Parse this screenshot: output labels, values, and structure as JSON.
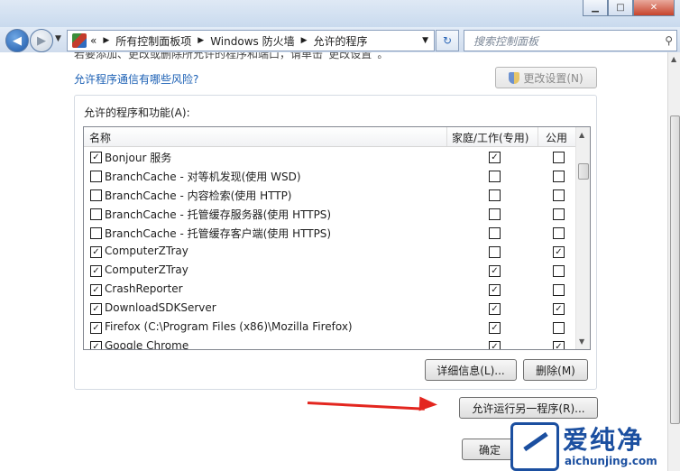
{
  "window": {
    "minimize": "▁",
    "maximize": "□",
    "close": "✕"
  },
  "nav": {
    "breadcrumb": [
      "«",
      "所有控制面板项",
      "Windows 防火墙",
      "允许的程序"
    ],
    "search_placeholder": "搜索控制面板"
  },
  "page": {
    "cut_text": "若要添加、更改或删除所允许的程序和端口，请单击“更改设置”。",
    "risk_link": "允许程序通信有哪些风险?",
    "change_settings": "更改设置(N)",
    "group_label": "允许的程序和功能(A):",
    "columns": [
      "名称",
      "家庭/工作(专用)",
      "公用"
    ],
    "rows": [
      {
        "name": "Bonjour 服务",
        "enabled": true,
        "home": true,
        "public": false
      },
      {
        "name": "BranchCache - 对等机发现(使用 WSD)",
        "enabled": false,
        "home": false,
        "public": false
      },
      {
        "name": "BranchCache - 内容检索(使用 HTTP)",
        "enabled": false,
        "home": false,
        "public": false
      },
      {
        "name": "BranchCache - 托管缓存服务器(使用 HTTPS)",
        "enabled": false,
        "home": false,
        "public": false
      },
      {
        "name": "BranchCache - 托管缓存客户端(使用 HTTPS)",
        "enabled": false,
        "home": false,
        "public": false
      },
      {
        "name": "ComputerZTray",
        "enabled": true,
        "home": false,
        "public": true
      },
      {
        "name": "ComputerZTray",
        "enabled": true,
        "home": true,
        "public": false
      },
      {
        "name": "CrashReporter",
        "enabled": true,
        "home": true,
        "public": false
      },
      {
        "name": "DownloadSDKServer",
        "enabled": true,
        "home": true,
        "public": true
      },
      {
        "name": "Firefox (C:\\Program Files (x86)\\Mozilla Firefox)",
        "enabled": true,
        "home": true,
        "public": false
      },
      {
        "name": "Google Chrome",
        "enabled": true,
        "home": true,
        "public": true
      }
    ],
    "details_button": "详细信息(L)...",
    "remove_button": "删除(M)",
    "allow_another_button": "允许运行另一程序(R)...",
    "ok_button": "确定"
  },
  "watermark": {
    "title": "爱纯净",
    "url": "aichunjing.com"
  },
  "colors": {
    "link": "#1a5fb4",
    "annotation_arrow": "#e3261f",
    "watermark": "#1b4fa0"
  }
}
